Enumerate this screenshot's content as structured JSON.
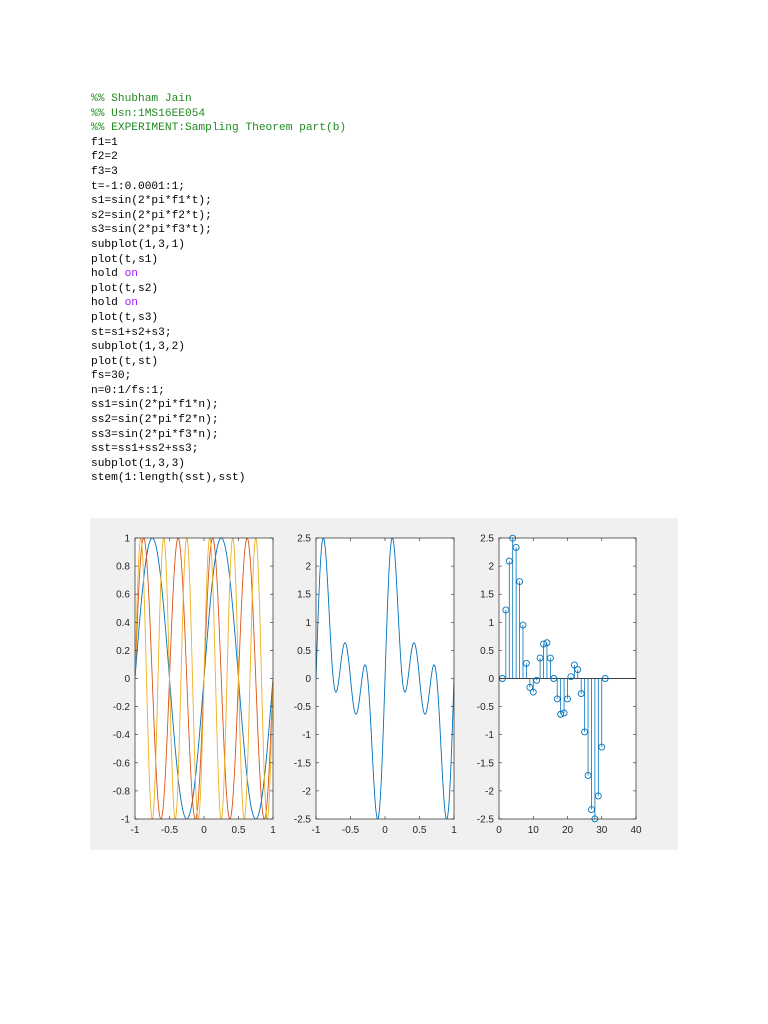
{
  "code": {
    "lines": [
      {
        "text": "%% Shubham Jain",
        "kind": "comment"
      },
      {
        "text": "%% Usn:1MS16EE054",
        "kind": "comment"
      },
      {
        "text": "%% EXPERIMENT:Sampling Theorem part(b)",
        "kind": "comment"
      },
      {
        "text": "f1=1"
      },
      {
        "text": "f2=2"
      },
      {
        "text": "f3=3"
      },
      {
        "text": "t=-1:0.0001:1;"
      },
      {
        "text": "s1=sin(2*pi*f1*t);"
      },
      {
        "text": "s2=sin(2*pi*f2*t);"
      },
      {
        "text": "s3=sin(2*pi*f3*t);"
      },
      {
        "text": "subplot(1,3,1)"
      },
      {
        "text": "plot(t,s1)"
      },
      {
        "text": "hold ",
        "keyword": "on"
      },
      {
        "text": "plot(t,s2)"
      },
      {
        "text": "hold ",
        "keyword": "on"
      },
      {
        "text": "plot(t,s3)"
      },
      {
        "text": "st=s1+s2+s3;"
      },
      {
        "text": "subplot(1,3,2)"
      },
      {
        "text": "plot(t,st)"
      },
      {
        "text": "fs=30;"
      },
      {
        "text": "n=0:1/fs:1;"
      },
      {
        "text": "ss1=sin(2*pi*f1*n);"
      },
      {
        "text": "ss2=sin(2*pi*f2*n);"
      },
      {
        "text": "ss3=sin(2*pi*f3*n);"
      },
      {
        "text": "sst=ss1+ss2+ss3;"
      },
      {
        "text": "subplot(1,3,3)"
      },
      {
        "text": "stem(1:length(sst),sst)"
      }
    ]
  },
  "colors": {
    "comment": "#228B22",
    "keyword": "#A020F0",
    "figure_bg": "#f0f0f0",
    "series_blue": "#0072BD",
    "series_orange": "#D95319",
    "series_yellow": "#EDB120"
  },
  "chart_data": [
    {
      "type": "line",
      "series_expressions": [
        "sin(2*pi*1*t)",
        "sin(2*pi*2*t)",
        "sin(2*pi*3*t)"
      ],
      "xlim": [
        -1,
        1
      ],
      "ylim": [
        -1,
        1
      ],
      "xticks": [
        "-1",
        "-0.5",
        "0",
        "0.5",
        "1"
      ],
      "yticks": [
        "1",
        "0.8",
        "0.6",
        "0.4",
        "0.2",
        "0",
        "-0.2",
        "-0.4",
        "-0.6",
        "-0.8",
        "-1"
      ]
    },
    {
      "type": "line",
      "series_expressions": [
        "sin(2*pi*1*t)+sin(2*pi*2*t)+sin(2*pi*3*t)"
      ],
      "xlim": [
        -1,
        1
      ],
      "ylim": [
        -2.5,
        2.5
      ],
      "xticks": [
        "-1",
        "-0.5",
        "0",
        "0.5",
        "1"
      ],
      "yticks": [
        "2.5",
        "2",
        "1.5",
        "1",
        "0.5",
        "0",
        "-0.5",
        "-1",
        "-1.5",
        "-2",
        "-2.5"
      ]
    },
    {
      "type": "stem",
      "x": [
        1,
        2,
        3,
        4,
        5,
        6,
        7,
        8,
        9,
        10,
        11,
        12,
        13,
        14,
        15,
        16,
        17,
        18,
        19,
        20,
        21,
        22,
        23,
        24,
        25,
        26,
        27,
        28,
        29,
        30,
        31
      ],
      "values": [
        0,
        1.2208,
        2.0889,
        2.4972,
        2.3313,
        1.7253,
        0.9511,
        0.2681,
        -0.1581,
        -0.2421,
        -0.0319,
        0.3633,
        0.6132,
        0.6361,
        0.3632,
        0,
        -0.3632,
        -0.6361,
        -0.6132,
        -0.3633,
        0.0319,
        0.2421,
        0.1581,
        -0.2681,
        -0.9511,
        -1.7253,
        -2.3313,
        -2.4972,
        -2.0889,
        -1.2208,
        0
      ],
      "xlim": [
        0,
        40
      ],
      "ylim": [
        -2.5,
        2.5
      ],
      "xticks": [
        "0",
        "10",
        "20",
        "30",
        "40"
      ],
      "yticks": [
        "2.5",
        "2",
        "1.5",
        "1",
        "0.5",
        "0",
        "-0.5",
        "-1",
        "-1.5",
        "-2",
        "-2.5"
      ]
    }
  ]
}
